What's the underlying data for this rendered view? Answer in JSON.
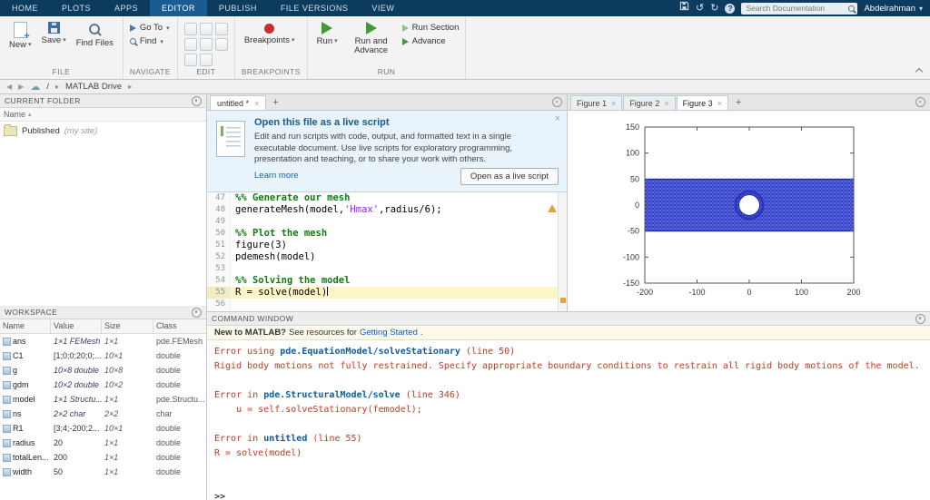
{
  "icons": {
    "dropdown": "▾",
    "close": "×",
    "new_tab": "+",
    "back": "◀",
    "forward": "▶",
    "crumb": "▸",
    "sort": "▴",
    "help": "?",
    "undo": "↺",
    "redo": "↻",
    "cloud": "☁",
    "root": "/"
  },
  "colors": {
    "toolstrip_blue": "#0c3b5e",
    "error_red": "#d0341d",
    "link_blue": "#0a5dab",
    "comment_green": "#0f7d0f",
    "string_purple": "#a020f0",
    "run_green": "#3f9c35",
    "warning_orange": "#e8a33d",
    "mesh_blue": "#2e3ccc"
  },
  "tabbar": {
    "tabs": [
      {
        "label": "HOME",
        "active": false
      },
      {
        "label": "PLOTS",
        "active": false
      },
      {
        "label": "APPS",
        "active": false
      },
      {
        "label": "EDITOR",
        "active": true
      },
      {
        "label": "PUBLISH",
        "active": false
      },
      {
        "label": "FILE VERSIONS",
        "active": false
      },
      {
        "label": "VIEW",
        "active": false
      }
    ],
    "search_placeholder": "Search Documentation",
    "user_name": "Abdelrahman"
  },
  "ribbon": {
    "file": {
      "label": "FILE",
      "buttons": [
        {
          "label": "New"
        },
        {
          "label": "Save"
        },
        {
          "label": "Find Files"
        }
      ]
    },
    "navigate": {
      "label": "NAVIGATE",
      "buttons": [
        {
          "label": "Go To"
        },
        {
          "label": "Find"
        }
      ]
    },
    "edit": {
      "label": "EDIT"
    },
    "breakpoints": {
      "label": "BREAKPOINTS",
      "button": {
        "label": "Breakpoints"
      }
    },
    "run": {
      "label": "RUN",
      "run": "Run",
      "run_and_advance": "Run and Advance",
      "run_section": "Run Section",
      "advance": "Advance"
    }
  },
  "breadcrumb": {
    "root": "/",
    "location": "MATLAB Drive"
  },
  "current_folder": {
    "title": "CURRENT FOLDER",
    "name_column": "Name",
    "items": [
      {
        "name": "Published",
        "annotation": "(my site)"
      }
    ]
  },
  "workspace": {
    "title": "WORKSPACE",
    "columns": [
      "Name",
      "Value",
      "Size",
      "Class"
    ],
    "rows": [
      {
        "name": "ans",
        "value": "1×1 FEMesh",
        "italic": true,
        "size": "1×1",
        "class": "pde.FEMesh"
      },
      {
        "name": "C1",
        "value": "[1;0;0;20;0;...",
        "italic": false,
        "size": "10×1",
        "class": "double"
      },
      {
        "name": "g",
        "value": "10×8 double",
        "italic": true,
        "size": "10×8",
        "class": "double"
      },
      {
        "name": "gdm",
        "value": "10×2 double",
        "italic": true,
        "size": "10×2",
        "class": "double"
      },
      {
        "name": "model",
        "value": "1×1 Structu...",
        "italic": true,
        "size": "1×1",
        "class": "pde.Structu..."
      },
      {
        "name": "ns",
        "value": "2×2 char",
        "italic": true,
        "size": "2×2",
        "class": "char"
      },
      {
        "name": "R1",
        "value": "[3;4;-200;2...",
        "italic": false,
        "size": "10×1",
        "class": "double"
      },
      {
        "name": "radius",
        "value": "20",
        "italic": false,
        "size": "1×1",
        "class": "double"
      },
      {
        "name": "totalLen...",
        "value": "200",
        "italic": false,
        "size": "1×1",
        "class": "double"
      },
      {
        "name": "width",
        "value": "50",
        "italic": false,
        "size": "1×1",
        "class": "double"
      }
    ]
  },
  "editor": {
    "tab_label": "untitled *",
    "banner": {
      "title": "Open this file as a live script",
      "body": "Edit and run scripts with code, output, and formatted text in a single executable document. Use live scripts for exploratory programming, presentation and teaching, or to share your work with others.",
      "learn_more": "Learn more",
      "button": "Open as a live script"
    },
    "code": {
      "start_line": 47,
      "lines": [
        {
          "segs": [
            {
              "t": "section",
              "x": "%% Generate our mesh"
            }
          ]
        },
        {
          "segs": [
            {
              "t": "plain",
              "x": "generateMesh(model,"
            },
            {
              "t": "string",
              "x": "'Hmax'"
            },
            {
              "t": "plain",
              "x": ",radius/6);"
            }
          ]
        },
        {
          "segs": []
        },
        {
          "segs": [
            {
              "t": "section",
              "x": "%% Plot the mesh"
            }
          ]
        },
        {
          "segs": [
            {
              "t": "plain",
              "x": "figure(3)"
            }
          ]
        },
        {
          "segs": [
            {
              "t": "plain",
              "x": "pdemesh(model)"
            }
          ]
        },
        {
          "segs": []
        },
        {
          "segs": [
            {
              "t": "section",
              "x": "%% Solving the model"
            }
          ]
        },
        {
          "segs": [
            {
              "t": "plain",
              "x": "R = solve(model)"
            }
          ],
          "current": true,
          "cursor": true
        },
        {
          "segs": []
        }
      ]
    }
  },
  "figures": {
    "tabs": [
      {
        "label": "Figure 1",
        "active": false
      },
      {
        "label": "Figure 2",
        "active": false
      },
      {
        "label": "Figure 3",
        "active": true
      }
    ]
  },
  "chart_data": {
    "type": "mesh",
    "description": "pdemesh(model): triangular FE mesh of a rectangular plate with a central circular hole",
    "xlim": [
      -200,
      200
    ],
    "ylim": [
      -150,
      150
    ],
    "xticks": [
      -200,
      -100,
      0,
      100,
      200
    ],
    "yticks": [
      -150,
      -100,
      -50,
      0,
      50,
      100,
      150
    ],
    "region": {
      "x": [
        -200,
        200
      ],
      "y": [
        -50,
        50
      ]
    },
    "hole": {
      "cx": 0,
      "cy": 0,
      "r": 20
    },
    "mesh_color": "#2e3ccc",
    "mesh_edge_color": "#121fa6"
  },
  "command_window": {
    "title": "COMMAND WINDOW",
    "banner": {
      "bold": "New to MATLAB?",
      "text": " See resources for ",
      "link": "Getting Started",
      "suffix": "."
    },
    "lines": [
      [
        {
          "t": "err",
          "x": "Error using "
        },
        {
          "t": "link",
          "x": "pde.EquationModel/solveStationary"
        },
        {
          "t": "err",
          "x": " (line 50)"
        }
      ],
      [
        {
          "t": "err",
          "x": "Rigid body motions not fully restrained. Specify appropriate boundary conditions to restrain all rigid body motions of the model."
        }
      ],
      [],
      [
        {
          "t": "err",
          "x": "Error in "
        },
        {
          "t": "link",
          "x": "pde.StructuralModel/solve"
        },
        {
          "t": "err",
          "x": " (line 346)"
        }
      ],
      [
        {
          "t": "err",
          "x": "    u = self.solveStationary(femodel);"
        }
      ],
      [],
      [
        {
          "t": "err",
          "x": "Error in "
        },
        {
          "t": "link",
          "x": "untitled"
        },
        {
          "t": "err",
          "x": " (line 55)"
        }
      ],
      [
        {
          "t": "err",
          "x": "R = solve(model)"
        }
      ],
      [],
      []
    ],
    "prompt": ">>"
  }
}
